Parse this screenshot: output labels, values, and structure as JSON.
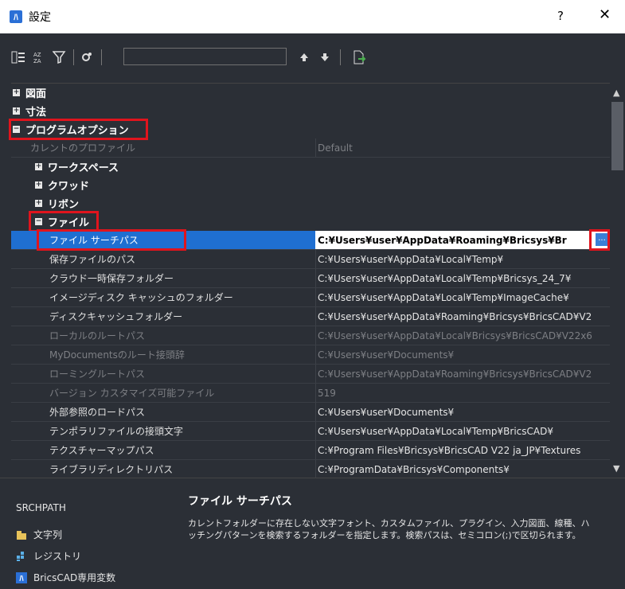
{
  "window": {
    "title": "設定",
    "help": "?",
    "close": "✕"
  },
  "toolbar": {
    "search_value": "",
    "icons": [
      "categorized-view-icon",
      "alphabetical-sort-icon",
      "filter-icon",
      "settings-icon",
      "move-up-icon",
      "move-down-icon",
      "export-icon"
    ]
  },
  "tree": {
    "cat_drawing": "図面",
    "cat_dimension": "寸法",
    "cat_program_options": "プログラムオプション",
    "current_profile_label": "カレントのプロファイル",
    "current_profile_value": "Default",
    "cat_workspace": "ワークスペース",
    "cat_quad": "クワッド",
    "cat_ribbon": "リボン",
    "cat_file": "ファイル",
    "props": [
      {
        "name": "ファイル サーチパス",
        "value": "C:¥Users¥user¥AppData¥Roaming¥Bricsys¥Br"
      },
      {
        "name": "保存ファイルのパス",
        "value": "C:¥Users¥user¥AppData¥Local¥Temp¥"
      },
      {
        "name": "クラウド一時保存フォルダー",
        "value": "C:¥Users¥user¥AppData¥Local¥Temp¥Bricsys_24_7¥"
      },
      {
        "name": "イメージディスク キャッシュのフォルダー",
        "value": "C:¥Users¥user¥AppData¥Local¥Temp¥ImageCache¥"
      },
      {
        "name": "ディスクキャッシュフォルダー",
        "value": "C:¥Users¥user¥AppData¥Roaming¥Bricsys¥BricsCAD¥V2"
      },
      {
        "name": "ローカルのルートパス",
        "value": "C:¥Users¥user¥AppData¥Local¥Bricsys¥BricsCAD¥V22x6"
      },
      {
        "name": "MyDocumentsのルート接頭辞",
        "value": "C:¥Users¥user¥Documents¥"
      },
      {
        "name": "ローミングルートパス",
        "value": "C:¥Users¥user¥AppData¥Roaming¥Bricsys¥BricsCAD¥V2"
      },
      {
        "name": "バージョン カスタマイズ可能ファイル",
        "value": "519"
      },
      {
        "name": "外部参照のロードパス",
        "value": "C:¥Users¥user¥Documents¥"
      },
      {
        "name": "テンポラリファイルの接頭文字",
        "value": "C:¥Users¥user¥AppData¥Local¥Temp¥BricsCAD¥"
      },
      {
        "name": "テクスチャーマップパス",
        "value": "C:¥Program Files¥Bricsys¥BricsCAD V22 ja_JP¥Textures"
      },
      {
        "name": "ライブラリディレクトリパス",
        "value": "C:¥ProgramData¥Bricsys¥Components¥"
      }
    ],
    "browse_button": "..."
  },
  "bottom": {
    "variable_name": "SRCHPATH",
    "desc_title": "ファイル サーチパス",
    "desc_line1": "カレントフォルダーに存在しない文字フォント、カスタムファイル、プラグイン、入力図面、線種、ハ",
    "desc_line2": "ッチングパターンを検索するフォルダーを指定します。検索パスは、セミコロン(;)で区切られます。",
    "legend_string": "文字列",
    "legend_registry": "レジストリ",
    "legend_bricscad": "BricsCAD専用変数"
  }
}
